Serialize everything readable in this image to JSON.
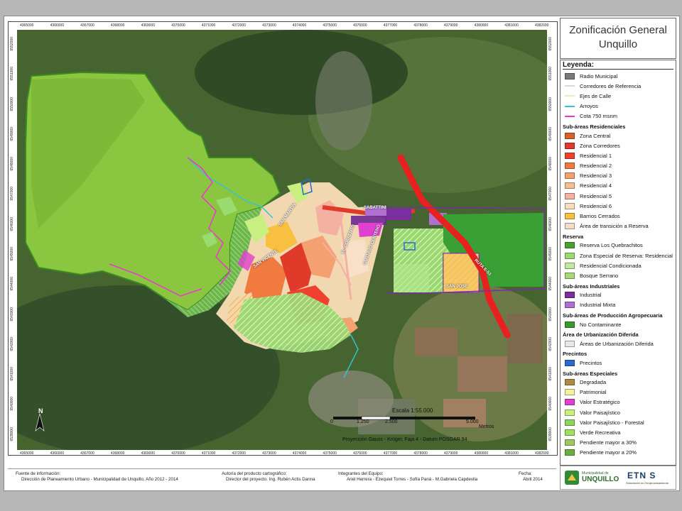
{
  "title": {
    "line1": "Zonificación General",
    "line2": "Unquillo"
  },
  "coords": {
    "x_ticks": [
      "4365000",
      "4366000",
      "4367000",
      "4368000",
      "4369000",
      "4370000",
      "4371000",
      "4372000",
      "4373000",
      "4374000",
      "4375000",
      "4376000",
      "4377000",
      "4378000",
      "4379000",
      "4380000",
      "4381000",
      "4382000"
    ],
    "y_ticks": [
      "6552000",
      "6551000",
      "6550000",
      "6549000",
      "6548000",
      "6547000",
      "6546000",
      "6545000",
      "6544000",
      "6543000",
      "6542000",
      "6541000",
      "6540000",
      "6539000"
    ]
  },
  "map": {
    "labels": [
      "SABATTINI",
      "SAN JOSE",
      "RUTA E-53",
      "SAN MARTIN",
      "EL CORRENTO",
      "GUSTAVO CENTENO",
      "SAN VICENTE"
    ],
    "scale_text": "Escala 1:55.000",
    "scale_ticks": [
      "0",
      "1.250",
      "2.500",
      "5.000"
    ],
    "scale_unit": "Metros",
    "projection": "Proyección Gauss - Krüger, Faja 4 - Datum POSGAR 94",
    "north_label": "N"
  },
  "legend": {
    "title": "Leyenda:",
    "sections": [
      {
        "heading": "",
        "items": [
          {
            "label": "Radio Municipal",
            "color": "#7a7a7a",
            "kind": "box"
          },
          {
            "label": "Corredores de Referencia",
            "color": "#d9d9d9",
            "kind": "line"
          },
          {
            "label": "Ejes de Calle",
            "color": "#f5e5c0",
            "kind": "line"
          },
          {
            "label": "Arroyos",
            "color": "#31c4d8",
            "kind": "line"
          },
          {
            "label": "Cota 750 msnm",
            "color": "#f034d2",
            "kind": "line"
          }
        ]
      },
      {
        "heading": "Sub-áreas Residenciales",
        "items": [
          {
            "label": "Zona Central",
            "color": "#d4622a",
            "kind": "box"
          },
          {
            "label": "Zona Corredores",
            "color": "#e03a2a",
            "kind": "box"
          },
          {
            "label": "Residencial 1",
            "color": "#f04030",
            "kind": "box"
          },
          {
            "label": "Residencial  2",
            "color": "#f07a40",
            "kind": "box"
          },
          {
            "label": "Residencial  3",
            "color": "#f4a070",
            "kind": "box"
          },
          {
            "label": "Residencial  4",
            "color": "#f2c090",
            "kind": "box"
          },
          {
            "label": "Residencial 5",
            "color": "#f4b0a0",
            "kind": "box"
          },
          {
            "label": "Residencial 6",
            "color": "#f8dcc0",
            "kind": "box"
          },
          {
            "label": "Barrios Cerrados",
            "color": "#f8c040",
            "kind": "box"
          },
          {
            "label": "Área de transición a Reserva",
            "color": "#f3dcc8",
            "kind": "box"
          }
        ]
      },
      {
        "heading": "Reserva",
        "items": [
          {
            "label": "Reserva Los Quebrachitos",
            "color": "#4aa030",
            "kind": "box"
          },
          {
            "label": "Zona Especial de Reserva: Residencial",
            "color": "#9adb70",
            "kind": "box"
          },
          {
            "label": "Residencial Condicionada",
            "color": "#bfe8a0",
            "kind": "box"
          },
          {
            "label": "Bosque Serrano",
            "color": "#a8d878",
            "kind": "box"
          }
        ]
      },
      {
        "heading": "Sub-áreas Industriales",
        "items": [
          {
            "label": "Industrial",
            "color": "#7a2ea0",
            "kind": "box"
          },
          {
            "label": "Industrial Mixta",
            "color": "#b070d0",
            "kind": "box"
          }
        ]
      },
      {
        "heading": "Sub-áreas de Producción Agropecuaria",
        "items": [
          {
            "label": "No Contaminante",
            "color": "#3a9a30",
            "kind": "box"
          }
        ]
      },
      {
        "heading": "Área de Urbanización Diferida",
        "items": [
          {
            "label": "Áreas de Urbanización Diferida",
            "color": "#e8e8e8",
            "kind": "box"
          }
        ]
      },
      {
        "heading": "Precintos",
        "items": [
          {
            "label": "Precintos",
            "color": "#2a6ad0",
            "kind": "box"
          }
        ]
      },
      {
        "heading": "Sub-áreas Especiales",
        "items": [
          {
            "label": "Degradada",
            "color": "#b08a40",
            "kind": "box"
          },
          {
            "label": "Patrimonial",
            "color": "#f4f0a0",
            "kind": "box"
          },
          {
            "label": "Valor Estratégico",
            "color": "#e040d0",
            "kind": "box"
          },
          {
            "label": "Valor Paisajístico",
            "color": "#c8f080",
            "kind": "box"
          },
          {
            "label": "Valor Paisajístico - Forestal",
            "color": "#8ad860",
            "kind": "box"
          },
          {
            "label": "Verde Recreativa",
            "color": "#a0e060",
            "kind": "box"
          },
          {
            "label": "Pendiente mayor a 30%",
            "color": "#9ec860",
            "kind": "box"
          },
          {
            "label": "Pendiente mayor a 20%",
            "color": "#6ab040",
            "kind": "box"
          }
        ]
      }
    ]
  },
  "footer": {
    "source_heading": "Fuente de información:",
    "source_text": "Dirección de Planeamiento Urbano - Municipalidad de Unquillo,  Año 2012 - 2014",
    "author_heading": "Autoría del producto cartográfico:",
    "author_text": "Director del proyecto: Ing. Rubén Actis Danna",
    "team_heading": "Integrantes del Equipo:",
    "team_text": "Ariel Herrera - Ezequiel Torres - Sofía Paná - M.Gabriela Capdevila",
    "date_heading": "Fecha:",
    "date_text": "Abril 2014"
  },
  "logos": {
    "muni_line1": "Municipalidad de",
    "muni_line2": "UNQUILLO",
    "etnos": "ETN S",
    "etnos_sub": "Soluciones en Geoprocesamiento"
  }
}
